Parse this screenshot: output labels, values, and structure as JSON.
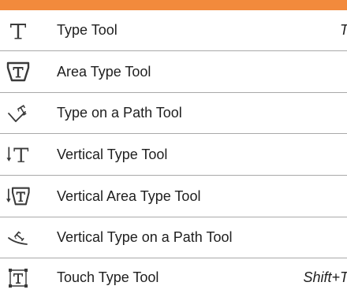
{
  "colors": {
    "accent": "#f28a3c",
    "text": "#1e1e1e",
    "divider": "#a9a9a9"
  },
  "menu": {
    "items": [
      {
        "label": "Type Tool",
        "shortcut": "T",
        "icon": "type-icon"
      },
      {
        "label": "Area Type Tool",
        "shortcut": "",
        "icon": "area-type-icon"
      },
      {
        "label": "Type on a Path Tool",
        "shortcut": "",
        "icon": "type-on-path-icon"
      },
      {
        "label": "Vertical Type Tool",
        "shortcut": "",
        "icon": "vertical-type-icon"
      },
      {
        "label": "Vertical Area Type Tool",
        "shortcut": "",
        "icon": "vertical-area-type-icon"
      },
      {
        "label": "Vertical Type on a Path Tool",
        "shortcut": "",
        "icon": "vertical-type-on-path-icon"
      },
      {
        "label": "Touch Type Tool",
        "shortcut": "Shift+T",
        "icon": "touch-type-icon"
      }
    ]
  }
}
